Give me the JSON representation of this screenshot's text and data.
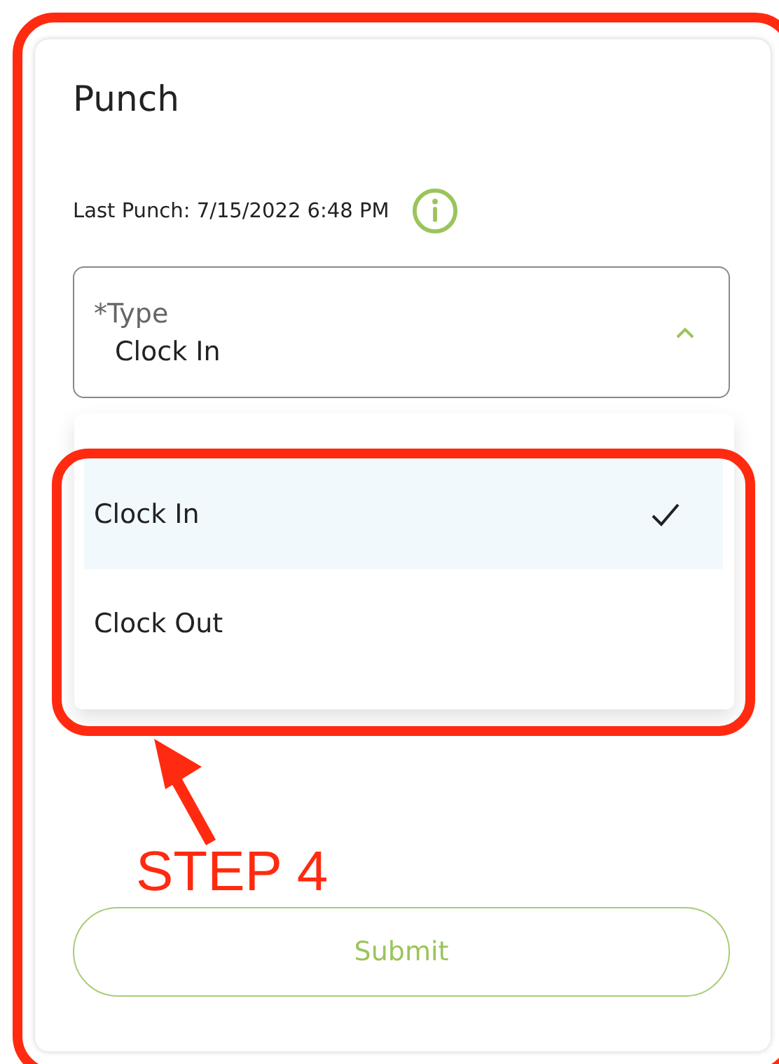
{
  "card": {
    "title": "Punch",
    "last_punch": "Last Punch: 7/15/2022 6:48 PM"
  },
  "type_field": {
    "label": "*Type",
    "value": "Clock In",
    "expanded": true
  },
  "options": [
    {
      "label": "Clock In",
      "selected": true
    },
    {
      "label": "Clock Out",
      "selected": false
    }
  ],
  "submit": {
    "label": "Submit"
  },
  "annotation": {
    "label": "STEP 4"
  }
}
